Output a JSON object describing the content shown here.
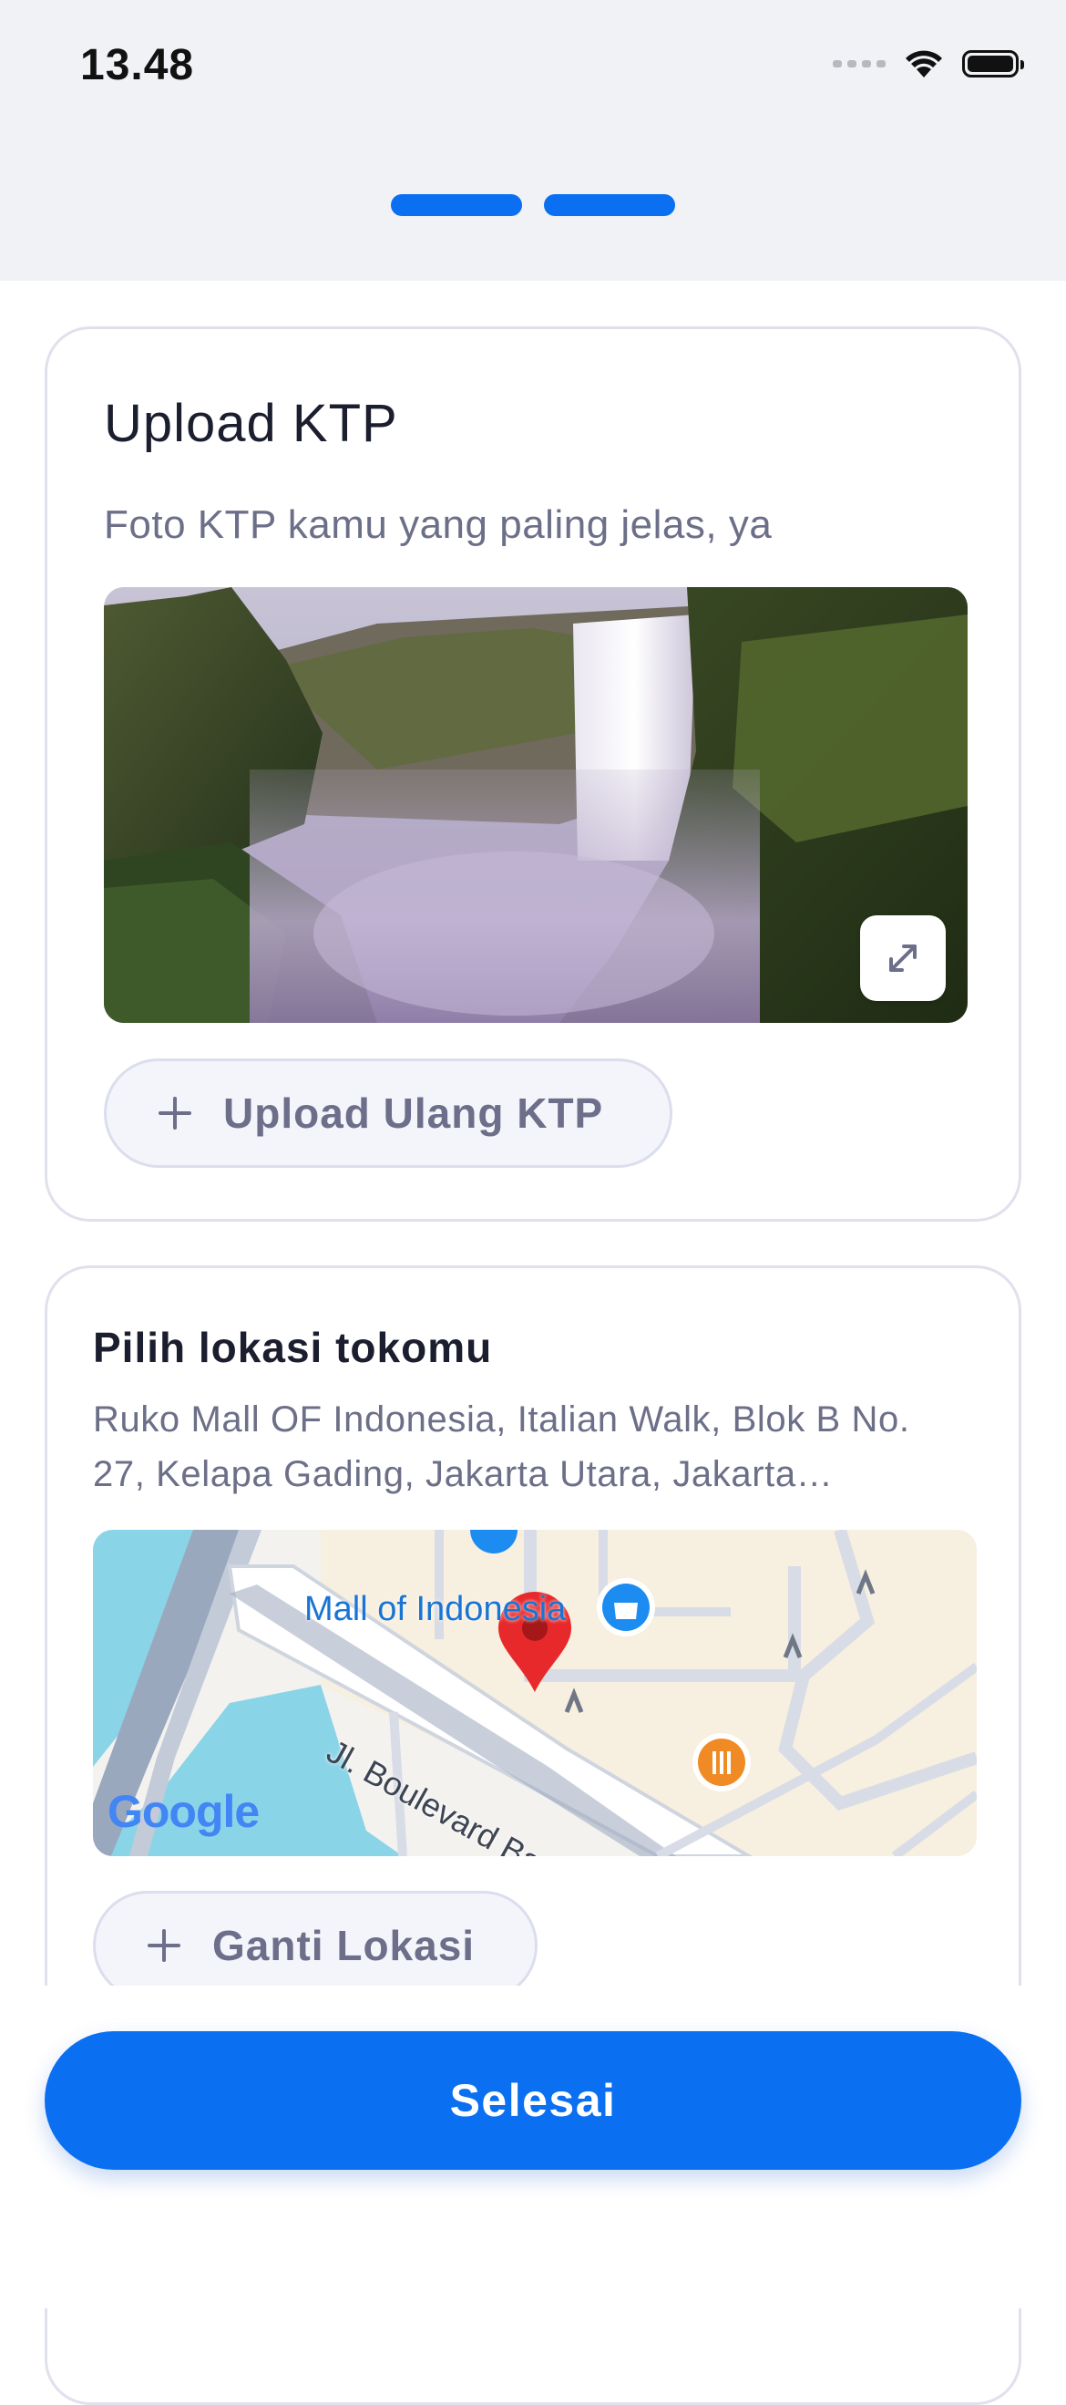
{
  "status_bar": {
    "time": "13.48"
  },
  "colors": {
    "accent": "#0a6ff0",
    "header_bg": "#f1f2f6",
    "muted_text": "#6c6f88",
    "card_border": "#dfe1ec"
  },
  "progress": {
    "steps_total": 2,
    "steps_completed": 2
  },
  "ktp_card": {
    "title": "Upload KTP",
    "subtitle": "Foto KTP kamu yang paling jelas, ya",
    "expand_icon": "expand-icon",
    "reupload_label": "Upload Ulang KTP"
  },
  "location_card": {
    "title": "Pilih lokasi tokomu",
    "address": "Ruko Mall OF Indonesia, Italian Walk, Blok B No. 27, Kelapa Gading, Jakarta Utara, Jakarta…",
    "map": {
      "place_label": "Mall of Indonesia",
      "street_label": "Jl. Boulevard Bar. Raya",
      "provider": "Google"
    },
    "change_label": "Ganti Lokasi"
  },
  "footer": {
    "submit_label": "Selesai"
  }
}
